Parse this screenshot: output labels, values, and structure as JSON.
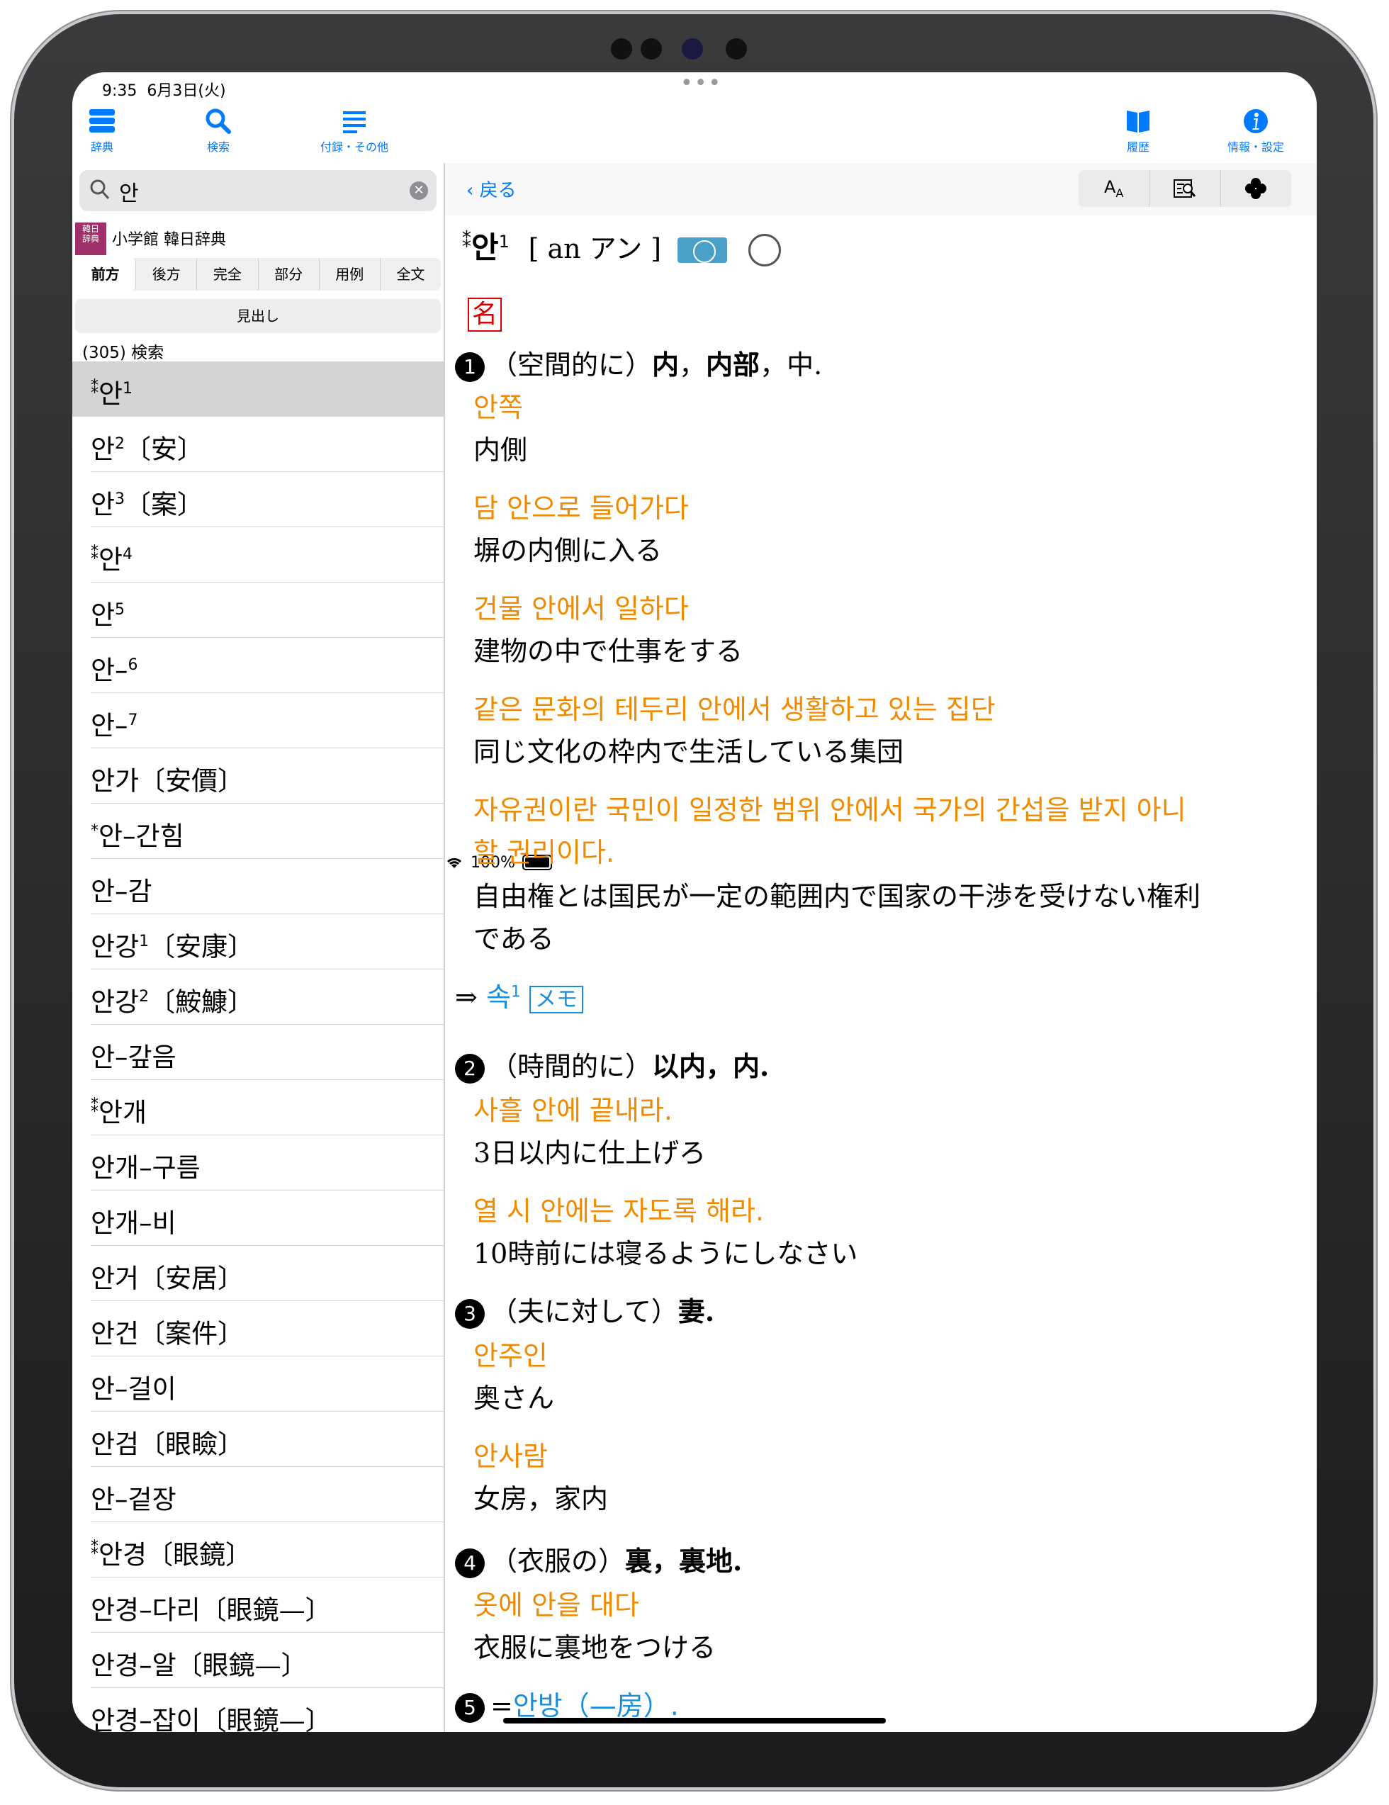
{
  "status": {
    "time": "9:35",
    "date": "6月3日(火)",
    "battery": "100%"
  },
  "toolbar": {
    "dictionary": "辞典",
    "search": "検索",
    "appendix": "付録・その他",
    "history": "履歴",
    "info": "情報・設定"
  },
  "search": {
    "value": "안"
  },
  "dictionary": {
    "name": "小学館 韓日辞典",
    "logo": "小学館\n韓日\n辞典"
  },
  "modes": [
    "前方",
    "後方",
    "完全",
    "部分",
    "用例",
    "全文"
  ],
  "midashi": "見出し",
  "result_count": "(305) 検索",
  "results": [
    {
      "mark": "⁑",
      "word": "안",
      "sup": "1",
      "kanji": ""
    },
    {
      "mark": "",
      "word": "안",
      "sup": "2",
      "kanji": "〔安〕"
    },
    {
      "mark": "",
      "word": "안",
      "sup": "3",
      "kanji": "〔案〕"
    },
    {
      "mark": "⁑",
      "word": "안",
      "sup": "4",
      "kanji": ""
    },
    {
      "mark": "",
      "word": "안",
      "sup": "5",
      "kanji": ""
    },
    {
      "mark": "",
      "word": "안–",
      "sup": "6",
      "kanji": ""
    },
    {
      "mark": "",
      "word": "안–",
      "sup": "7",
      "kanji": ""
    },
    {
      "mark": "",
      "word": "안가",
      "sup": "",
      "kanji": "〔安價〕"
    },
    {
      "mark": "*",
      "word": "안–간힘",
      "sup": "",
      "kanji": ""
    },
    {
      "mark": "",
      "word": "안–감",
      "sup": "",
      "kanji": ""
    },
    {
      "mark": "",
      "word": "안강",
      "sup": "1",
      "kanji": "〔安康〕"
    },
    {
      "mark": "",
      "word": "안강",
      "sup": "2",
      "kanji": "〔鮟鱇〕"
    },
    {
      "mark": "",
      "word": "안–갚음",
      "sup": "",
      "kanji": ""
    },
    {
      "mark": "⁑",
      "word": "안개",
      "sup": "",
      "kanji": ""
    },
    {
      "mark": "",
      "word": "안개–구름",
      "sup": "",
      "kanji": ""
    },
    {
      "mark": "",
      "word": "안개–비",
      "sup": "",
      "kanji": ""
    },
    {
      "mark": "",
      "word": "안거",
      "sup": "",
      "kanji": "〔安居〕"
    },
    {
      "mark": "",
      "word": "안건",
      "sup": "",
      "kanji": "〔案件〕"
    },
    {
      "mark": "",
      "word": "안–걸이",
      "sup": "",
      "kanji": ""
    },
    {
      "mark": "",
      "word": "안검",
      "sup": "",
      "kanji": "〔眼瞼〕"
    },
    {
      "mark": "",
      "word": "안–겉장",
      "sup": "",
      "kanji": ""
    },
    {
      "mark": "⁑",
      "word": "안경",
      "sup": "",
      "kanji": "〔眼鏡〕"
    },
    {
      "mark": "",
      "word": "안경–다리",
      "sup": "",
      "kanji": "〔眼鏡—〕"
    },
    {
      "mark": "",
      "word": "안경–알",
      "sup": "",
      "kanji": "〔眼鏡—〕"
    },
    {
      "mark": "",
      "word": "안경–잡이",
      "sup": "",
      "kanji": "〔眼鏡—〕"
    }
  ],
  "nav": {
    "back": "戻る",
    "font_size": "AA",
    "search_in": "⌕",
    "more": "✤"
  },
  "entry": {
    "mark": "⁑",
    "headword": "안",
    "sup": "1",
    "pron": "[ an アン ]",
    "pos": "名",
    "s1": {
      "num": "1",
      "def_a": "（空間的に）",
      "def_b": "内",
      "def_c": "，",
      "def_d": "内部",
      "def_e": "，中."
    },
    "ex1_ko": "안쪽",
    "ex1_ja": "内側",
    "ex2_ko": "담 안으로 들어가다",
    "ex2_ja": "塀の内側に入る",
    "ex3_ko": "건물 안에서 일하다",
    "ex3_ja": "建物の中で仕事をする",
    "ex4_ko": "같은 문화의 테두리 안에서 생활하고 있는 집단",
    "ex4_ja": "同じ文化の枠内で生活している集団",
    "ex5_ko1": "자유권이란 국민이 일정한 범위 안에서 국가의 간섭을 받지 아니",
    "ex5_ko2": "할 권리이다.",
    "ex5_ja1": "自由権とは国民が一定の範囲内で国家の干渉を受けない権利",
    "ex5_ja2": "である",
    "ref_arrow": "⇒",
    "ref": "속",
    "ref_sup": "1",
    "memo": "メモ",
    "s2": {
      "num": "2",
      "def_a": "（時間的に）",
      "def_b": "以内，内."
    },
    "ex6_ko": "사흘 안에 끝내라.",
    "ex6_ja": "3日以内に仕上げろ",
    "ex7_ko": "열 시 안에는 자도록 해라.",
    "ex7_ja": "10時前には寝るようにしなさい",
    "s3": {
      "num": "3",
      "def_a": "（夫に対して）",
      "def_b": "妻."
    },
    "ex8_ko": "안주인",
    "ex8_ja": "奥さん",
    "ex9_ko": "안사람",
    "ex9_ja": "女房，家内",
    "s4": {
      "num": "4",
      "def_a": "（衣服の）",
      "def_b": "裏，裏地."
    },
    "ex10_ko": "옷에 안을 대다",
    "ex10_ja": "衣服に裏地をつける",
    "s5": {
      "num": "5",
      "eq": "=",
      "link": "안방（—房）."
    }
  },
  "colors": {
    "accent": "#007aff",
    "korean_example": "#f08a00",
    "link": "#1a8fd8",
    "pos": "#dd0000"
  }
}
